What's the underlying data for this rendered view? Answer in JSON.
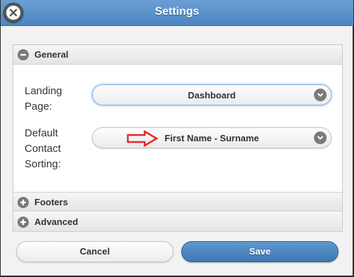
{
  "dialog": {
    "title": "Settings",
    "close_icon": "close-icon"
  },
  "sections": {
    "general": {
      "label": "General",
      "state": "expanded",
      "icon": "minus-icon"
    },
    "footers": {
      "label": "Footers",
      "state": "collapsed",
      "icon": "plus-icon"
    },
    "advanced": {
      "label": "Advanced",
      "state": "collapsed",
      "icon": "plus-icon"
    }
  },
  "fields": {
    "landing_page": {
      "label_line1": "Landing",
      "label_line2": "Page:",
      "value": "Dashboard"
    },
    "contact_sorting": {
      "label_line1": "Default",
      "label_line2": "Contact",
      "label_line3": "Sorting:",
      "value": "First Name - Surname"
    }
  },
  "buttons": {
    "cancel": "Cancel",
    "save": "Save"
  },
  "colors": {
    "header": "#4b86c2",
    "save_button": "#3f77b0",
    "annotation_arrow": "#e8242b"
  }
}
